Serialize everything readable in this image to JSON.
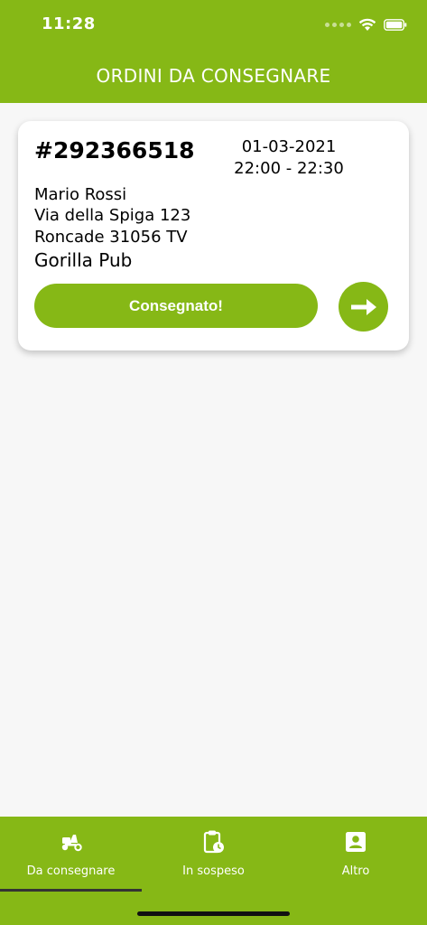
{
  "status_bar": {
    "time": "11:28"
  },
  "header": {
    "title": "ORDINI DA CONSEGNARE"
  },
  "order": {
    "number": "#292366518",
    "date": "01-03-2021",
    "time_slot": "22:00 - 22:30",
    "customer_name": "Mario Rossi",
    "street": "Via della Spiga 123",
    "city": "Roncade 31056 TV",
    "place": "Gorilla Pub",
    "delivered_label": "Consegnato!",
    "open_icon": "arrow-right-icon"
  },
  "tabs": [
    {
      "label": "Da consegnare",
      "icon": "scooter-icon",
      "active": true
    },
    {
      "label": "In sospeso",
      "icon": "clipboard-clock-icon",
      "active": false
    },
    {
      "label": "Altro",
      "icon": "contact-card-icon",
      "active": false
    }
  ],
  "colors": {
    "accent": "#86b816",
    "background": "#f7f7f7",
    "card": "#ffffff"
  }
}
